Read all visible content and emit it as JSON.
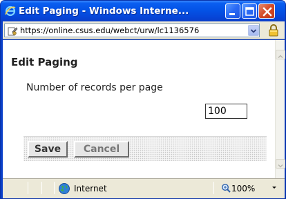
{
  "window": {
    "title": "Edit Paging - Windows Interne..."
  },
  "address_bar": {
    "url": "https://online.csus.edu/webct/urw/lc1136576"
  },
  "page": {
    "heading": "Edit Paging",
    "records_label": "Number of records per page",
    "records_value": "100",
    "save_label": "Save",
    "cancel_label": "Cancel"
  },
  "status_bar": {
    "zone": "Internet",
    "zoom": "100%"
  },
  "icons": {
    "title": "ie-logo-icon",
    "address": "page-security-icon",
    "lock": "padlock-icon",
    "zone": "internet-globe-icon",
    "zoom": "magnifier-icon"
  },
  "colors": {
    "titlebar": "#0453e6",
    "close_button": "#d44a26",
    "chrome": "#ece9d8"
  }
}
